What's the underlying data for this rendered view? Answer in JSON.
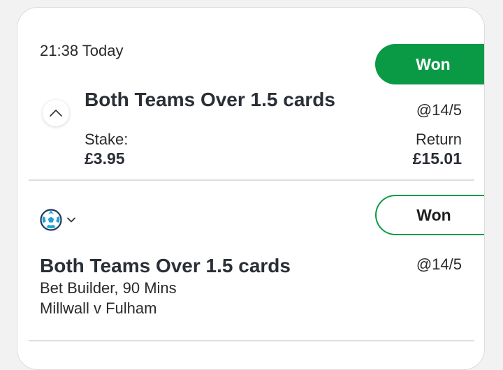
{
  "bet_slip": {
    "time": "21:38 Today",
    "status": "Won",
    "selection": "Both Teams Over 1.5 cards",
    "odds": "@14/5",
    "stake_label": "Stake:",
    "stake_value": "£3.95",
    "return_label": "Return",
    "return_value": "£15.01"
  },
  "leg": {
    "sport_icon": "football-icon",
    "status": "Won",
    "selection": "Both Teams Over 1.5 cards",
    "odds": "@14/5",
    "market": "Bet Builder, 90 Mins",
    "event": "Millwall v Fulham"
  },
  "colors": {
    "won_green": "#0a9a45",
    "text_dark": "#2a2f36"
  }
}
